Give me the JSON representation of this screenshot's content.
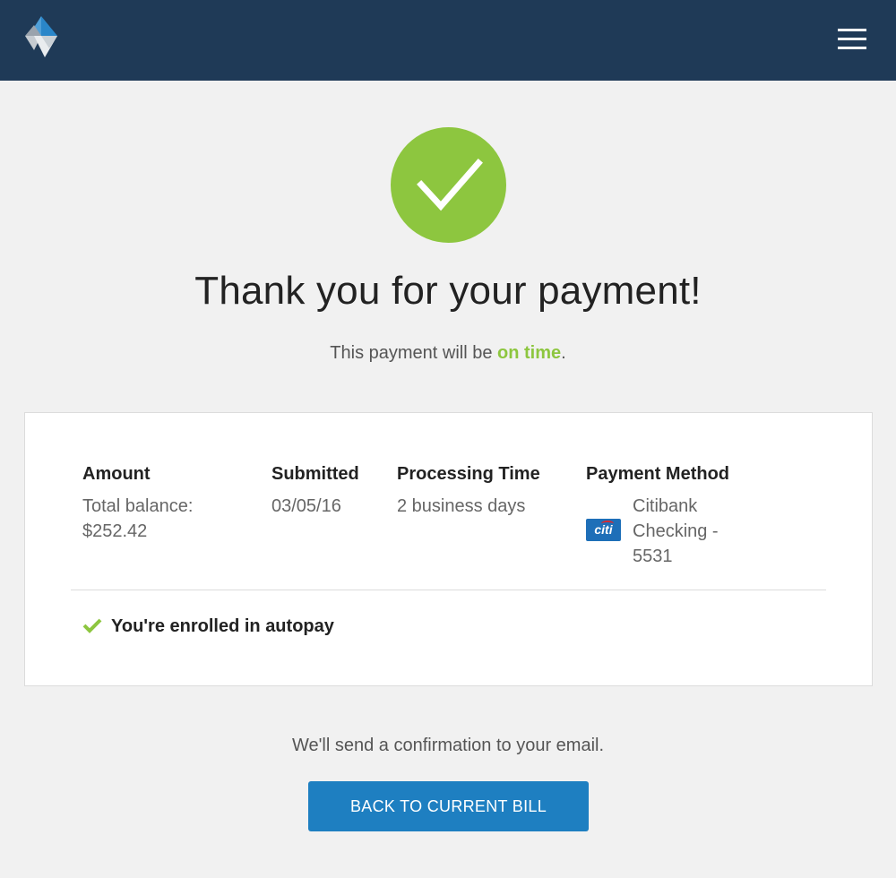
{
  "header": {
    "logo_icon": "diamond-logo-icon",
    "menu_icon": "hamburger-menu-icon",
    "background": "#1f3a57"
  },
  "status": {
    "icon": "checkmark-icon",
    "color": "#8dc63f"
  },
  "headline": "Thank you for your payment!",
  "subline": {
    "prefix": "This payment will be ",
    "highlight": "on time",
    "suffix": "."
  },
  "details": {
    "amount": {
      "label": "Amount",
      "line1": "Total balance:",
      "line2": "$252.42"
    },
    "submitted": {
      "label": "Submitted",
      "value": "03/05/16"
    },
    "processing": {
      "label": "Processing Time",
      "value": "2 business days"
    },
    "method": {
      "label": "Payment Method",
      "bank_logo_text": "citi",
      "line1": "Citibank",
      "line2": "Checking -",
      "line3": "5531"
    }
  },
  "autopay": {
    "icon": "checkmark-icon",
    "label": "You're enrolled in autopay"
  },
  "footer": {
    "note": "We'll send a confirmation to your email.",
    "button_label": "BACK TO CURRENT BILL",
    "button_color": "#1e7fc1"
  }
}
